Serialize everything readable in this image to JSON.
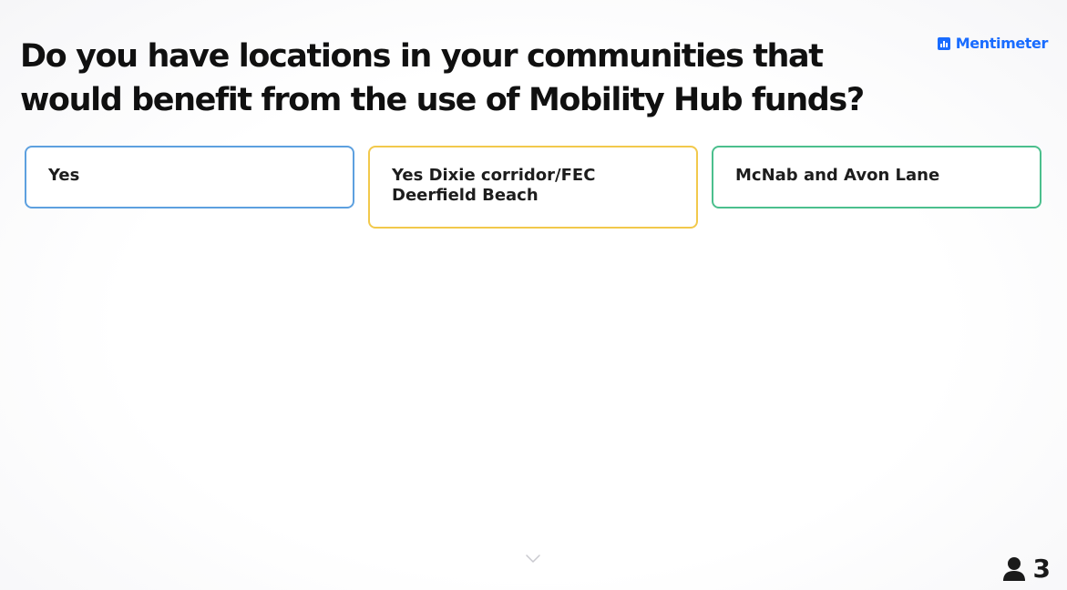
{
  "question": {
    "title": "Do you have locations in your communities that would benefit from the use of Mobility Hub funds?"
  },
  "brand": {
    "name": "Mentimeter",
    "icon": "bar-chart-icon",
    "color": "#196cff"
  },
  "responses": [
    {
      "text": "Yes",
      "border_color": "#5da0df"
    },
    {
      "text": "Yes Dixie corridor/FEC Deerfield Beach",
      "border_color": "#f2c94c"
    },
    {
      "text": "McNab and Avon Lane",
      "border_color": "#4bbf8d"
    }
  ],
  "footer": {
    "participant_count": "3",
    "participant_icon": "user-icon",
    "scroll_icon": "chevron-down-icon"
  }
}
